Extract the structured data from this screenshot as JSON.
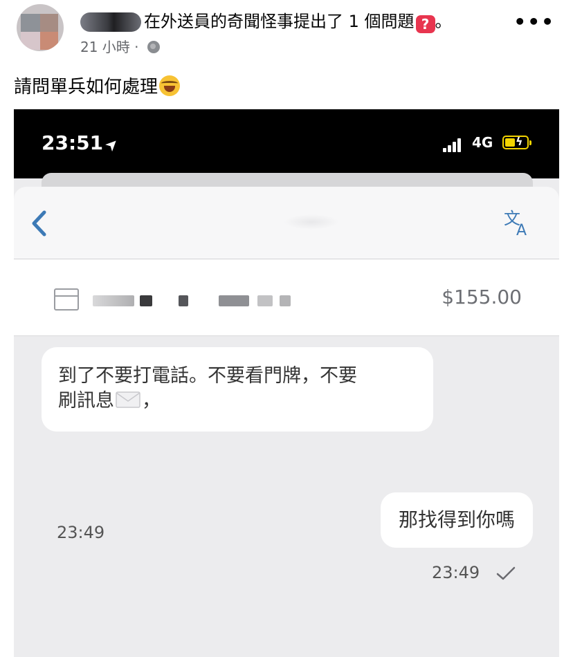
{
  "post": {
    "group_action": "在外送員的奇聞怪事提出了 1 個問題",
    "question_badge": "?",
    "title_end": "。",
    "time": "21 小時",
    "separator": "·",
    "more": "•••",
    "text": "請問單兵如何處理"
  },
  "phone": {
    "status": {
      "time": "23:51",
      "location_arrow": "➤",
      "network": "4G"
    },
    "order": {
      "price": "$155.00"
    },
    "messages": [
      {
        "direction": "incoming",
        "line1": "到了不要打電話。不要看門牌，不要",
        "line2_pre": "刷訊息",
        "line2_post": "，",
        "time": "23:49"
      },
      {
        "direction": "outgoing",
        "text": "那找得到你嗎",
        "time": "23:49"
      }
    ]
  },
  "colors": {
    "accent_blue": "#3d7ab6",
    "question_red": "#e8354f",
    "battery_yellow": "#f3d400"
  },
  "icons": [
    "globe-icon",
    "laughing-emoji-icon",
    "back-chevron-icon",
    "translate-icon",
    "box-icon",
    "envelope-emoji-icon",
    "check-icon",
    "signal-icon",
    "battery-icon"
  ]
}
